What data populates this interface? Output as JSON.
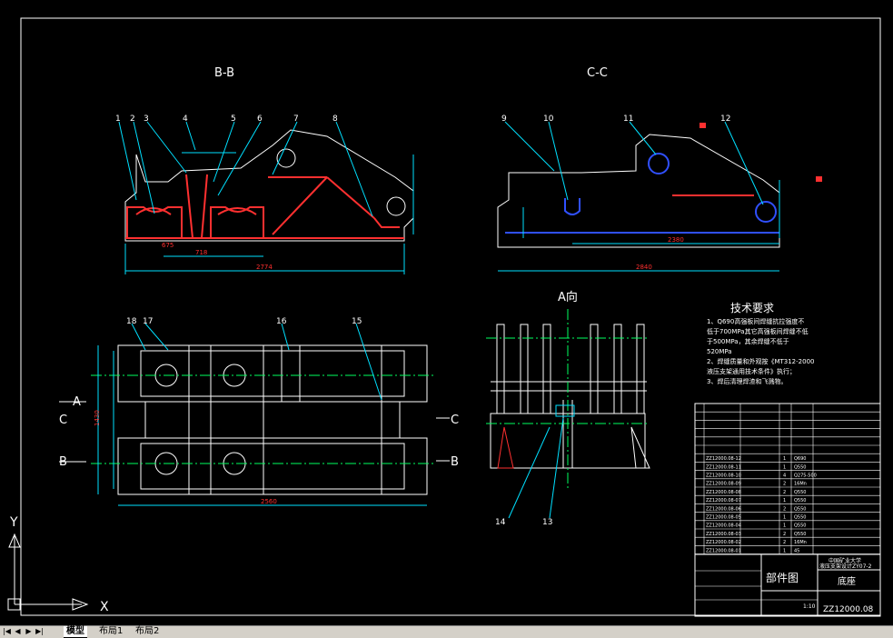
{
  "sheet": {
    "views": {
      "bb": "B-B",
      "cc": "C-C",
      "a": "A向"
    },
    "markers": {
      "a": "A",
      "b": "B",
      "c": "C"
    },
    "balloons_bb": [
      "1",
      "2",
      "3",
      "4",
      "5",
      "6",
      "7",
      "8"
    ],
    "balloons_cc": [
      "9",
      "10",
      "11",
      "12"
    ],
    "balloons_plan": [
      "18",
      "17",
      "16",
      "15"
    ],
    "balloons_a": [
      "14",
      "13"
    ],
    "dims": {
      "bb_total": "2774",
      "bb_mid": "718",
      "bb_side": "675",
      "cc_total": "2840",
      "cc_inner": "2380",
      "plan_total": "2560",
      "plan_height": "1430"
    }
  },
  "tech": {
    "title": "技术要求",
    "lines": [
      "1、Q690高强板间焊缝抗拉强度不",
      "低于700MPa其它高强板间焊缝不低",
      "于500MPa，其余焊缝不低于",
      "520MPa",
      "2、焊缝质量和外观按《MT312-2000",
      "液压支架通用技术条件》执行；",
      "3、焊后清理焊渣和飞溅物。"
    ]
  },
  "bom": {
    "rows": [
      [
        "ZZ12000.08-12",
        "",
        "1",
        "Q690"
      ],
      [
        "ZZ12000.08-11",
        "",
        "1",
        "Q550"
      ],
      [
        "ZZ12000.08-10",
        "",
        "4",
        "Q275-500"
      ],
      [
        "ZZ12000.08-09",
        "",
        "2",
        "16Mn"
      ],
      [
        "ZZ12000.08-08",
        "",
        "2",
        "Q550"
      ],
      [
        "ZZ12000.08-07",
        "",
        "1",
        "Q550"
      ],
      [
        "ZZ12000.08-06",
        "",
        "2",
        "Q550"
      ],
      [
        "ZZ12000.08-05",
        "",
        "1",
        "Q550"
      ],
      [
        "ZZ12000.08-04",
        "",
        "1",
        "Q550"
      ],
      [
        "ZZ12000.08-03",
        "",
        "2",
        "Q550"
      ],
      [
        "ZZ12000.08-02",
        "",
        "2",
        "16Mn"
      ],
      [
        "ZZ12000.08-01",
        "",
        "1",
        "45"
      ]
    ],
    "school": "中国矿业大学",
    "project": "液压支架设计ZY07-2",
    "drawing_type": "部件图",
    "part_name": "底座",
    "scale": "1:10",
    "drawing_no": "ZZ12000.08"
  },
  "ucs": {
    "x": "X",
    "y": "Y"
  },
  "tabs": {
    "model": "模型",
    "layout1": "布局1",
    "layout2": "布局2"
  }
}
